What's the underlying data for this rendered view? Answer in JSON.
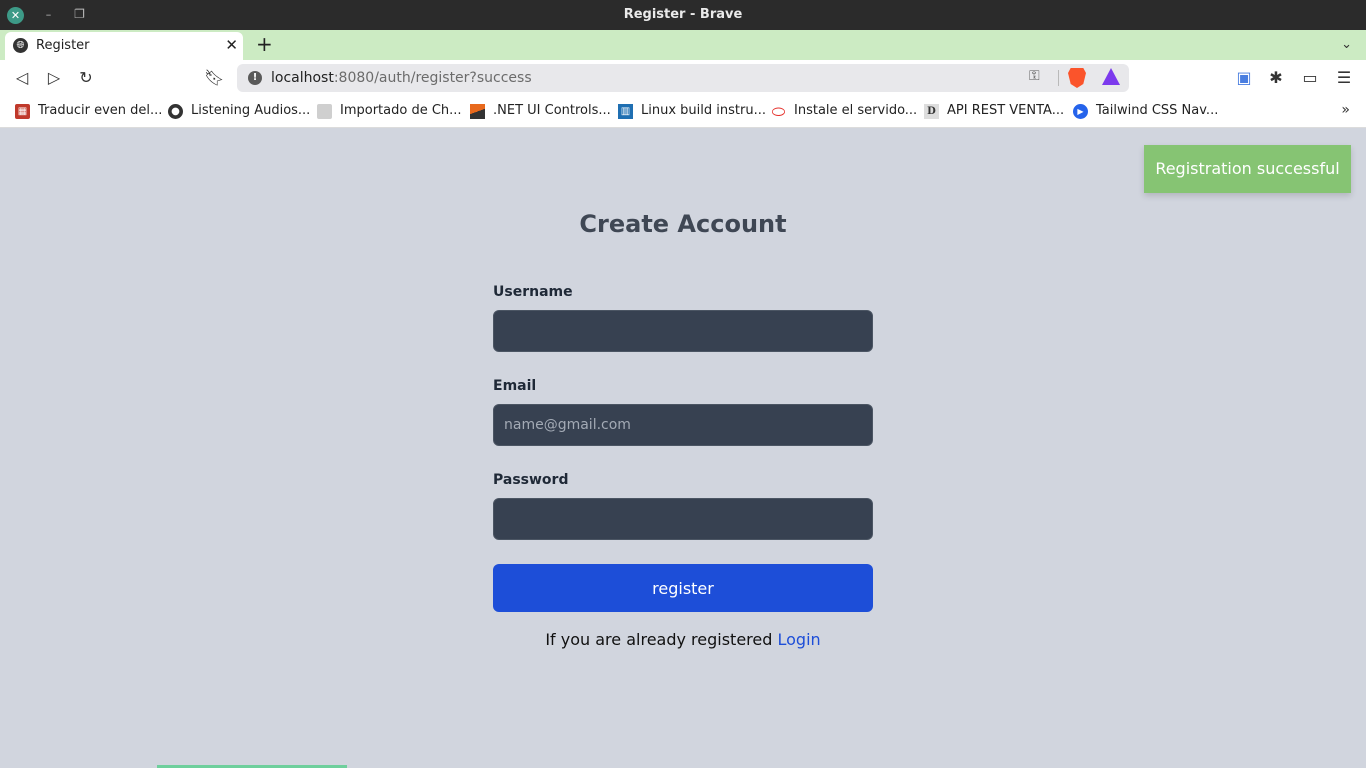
{
  "window": {
    "title": "Register - Brave",
    "minimize_glyph": "–",
    "maximize_glyph": "❐",
    "close_glyph": "✕"
  },
  "tabs": [
    {
      "title": "Register",
      "active": true
    }
  ],
  "toolbar": {
    "url_host": "localhost",
    "url_rest": ":8080/auth/register?success"
  },
  "bookmarks": [
    {
      "label": "Traducir even del...",
      "icon": "university-icon",
      "color": "#c0392b"
    },
    {
      "label": "Listening Audios...",
      "icon": "globe-icon",
      "color": "#333333"
    },
    {
      "label": "Importado de Ch...",
      "icon": "folder-icon",
      "color": "#bdbdbd"
    },
    {
      "label": ".NET UI Controls...",
      "icon": "telerik-icon",
      "color": "#e8691d"
    },
    {
      "label": "Linux build instru...",
      "icon": "chart-icon",
      "color": "#1f6fb2"
    },
    {
      "label": "Instale el servido...",
      "icon": "oracle-icon",
      "color": "#e5322d"
    },
    {
      "label": "API REST VENTA...",
      "icon": "d-icon",
      "color": "#555555"
    },
    {
      "label": "Tailwind CSS Nav...",
      "icon": "play-icon",
      "color": "#2563eb"
    }
  ],
  "toast": {
    "message": "Registration successful",
    "color": "#86c473"
  },
  "form": {
    "title": "Create Account",
    "username_label": "Username",
    "username_value": "",
    "email_label": "Email",
    "email_placeholder": "name@gmail.com",
    "password_label": "Password",
    "password_value": "",
    "submit_label": "register",
    "login_prompt": "If you are already registered",
    "login_link": "Login"
  },
  "colors": {
    "page_bg": "#d1d5de",
    "input_bg": "#374151",
    "button_bg": "#1d4ed8",
    "tabstrip_bg": "#ccebc3"
  }
}
